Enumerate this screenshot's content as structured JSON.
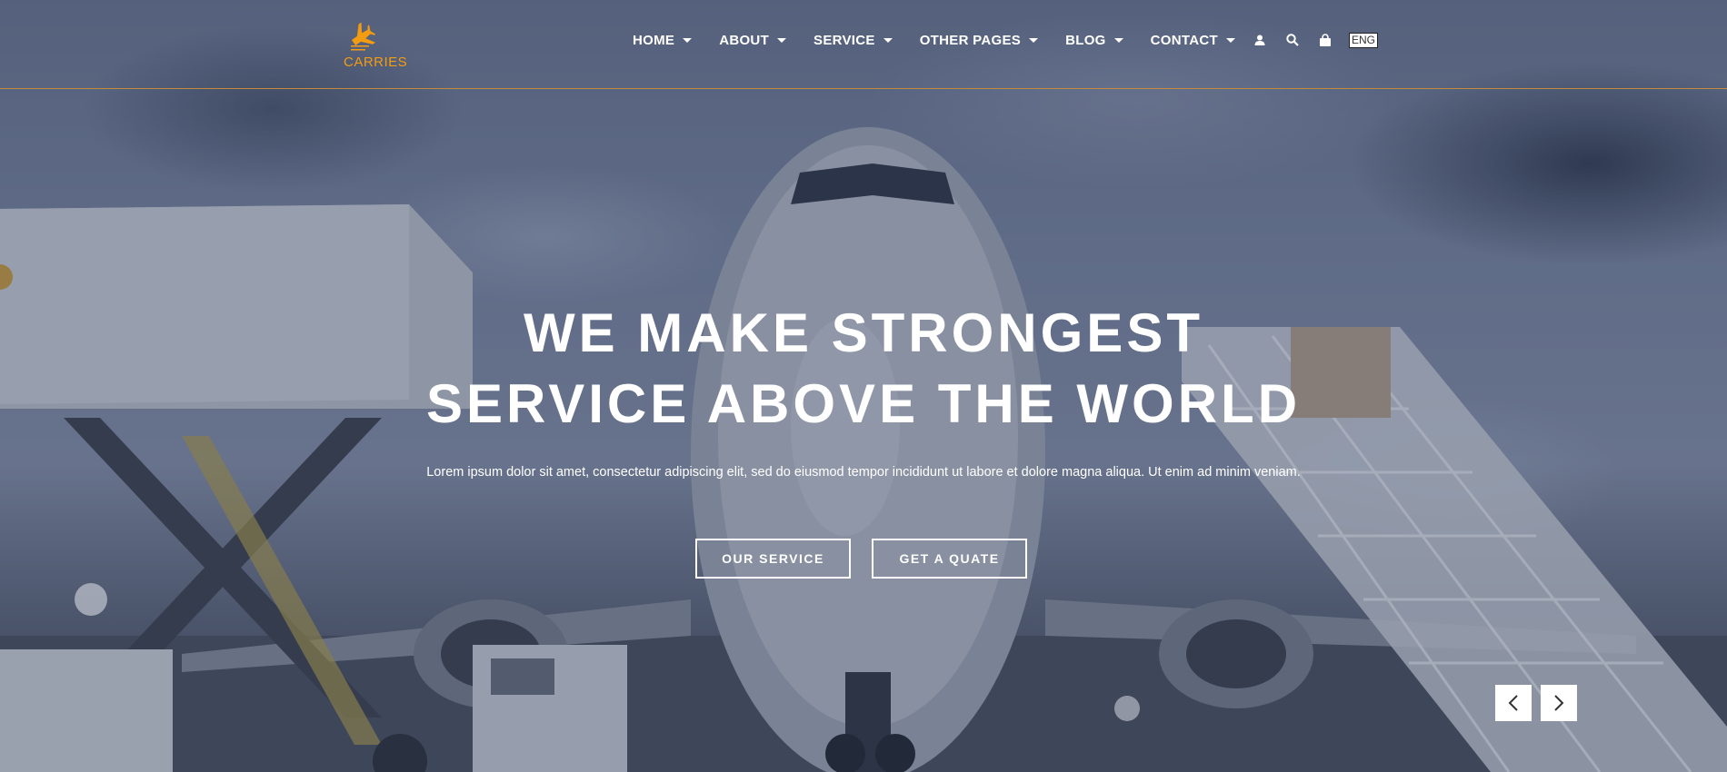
{
  "brand": {
    "name": "CARRIES",
    "accent": "#f39c12"
  },
  "nav": {
    "items": [
      {
        "label": "HOME"
      },
      {
        "label": "ABOUT"
      },
      {
        "label": "SERVICE"
      },
      {
        "label": "OTHER PAGES"
      },
      {
        "label": "BLOG"
      },
      {
        "label": "CONTACT"
      }
    ]
  },
  "tools": {
    "user_icon": "user-icon",
    "search_icon": "search-icon",
    "cart_icon": "shopping-bag-icon",
    "language": "ENG"
  },
  "hero": {
    "title_line1": "WE MAKE STRONGEST",
    "title_line2": "SERVICE ABOVE THE WORLD",
    "subtitle": "Lorem ipsum dolor sit amet, consectetur adipiscing elit, sed do eiusmod tempor incididunt ut labore et dolore magna aliqua. Ut enim ad minim veniam.",
    "primary_button": "OUR SERVICE",
    "secondary_button": "GET A QUATE"
  },
  "slider": {
    "prev_icon": "chevron-left-icon",
    "next_icon": "chevron-right-icon"
  },
  "background": {
    "accent_line": "#c28a3a"
  }
}
